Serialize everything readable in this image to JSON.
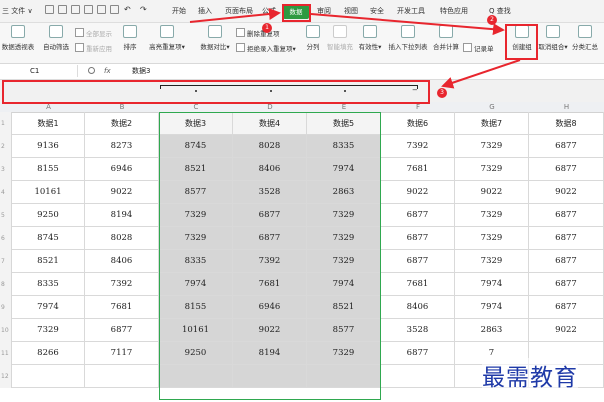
{
  "menu": {
    "file": "三 文件 ∨",
    "tabs": [
      "开始",
      "插入",
      "页面布局",
      "公式",
      "数据",
      "审阅",
      "视图",
      "安全",
      "开发工具",
      "特色应用"
    ],
    "active_tab": "数据",
    "search": "Q 查找"
  },
  "ribbon": {
    "pivot": "数据透视表",
    "auto_filter": "自动筛选",
    "show_all": "全部显示",
    "reapply": "重新应用",
    "sort": "排序",
    "highlight_dup": "高亮重复项",
    "compare": "数据对比",
    "remove_dup": "删除重复项",
    "reject_dup": "拒绝录入重复项",
    "split": "分列",
    "smart_fill": "智能填充",
    "validity": "有效性",
    "dropdown_list": "插入下拉列表",
    "merge_calc": "合并计算",
    "record_form": "记录单",
    "create_group": "创建组",
    "ungroup": "取消组合",
    "subtotal": "分类汇总"
  },
  "formula_bar": {
    "cell_ref": "C1",
    "fx": "fx",
    "content": "数据3"
  },
  "columns": [
    "A",
    "B",
    "C",
    "D",
    "E",
    "F",
    "G",
    "H"
  ],
  "rows": [
    "1",
    "2",
    "3",
    "4",
    "5",
    "6",
    "7",
    "8",
    "9",
    "10",
    "11",
    "12"
  ],
  "table": {
    "headers": [
      "数据1",
      "数据2",
      "数据3",
      "数据4",
      "数据5",
      "数据6",
      "数据7",
      "数据8"
    ],
    "data": [
      [
        "9136",
        "8273",
        "8745",
        "8028",
        "8335",
        "7392",
        "7329",
        "6877"
      ],
      [
        "8155",
        "6946",
        "8521",
        "8406",
        "7974",
        "7681",
        "7329",
        "6877"
      ],
      [
        "10161",
        "9022",
        "8577",
        "3528",
        "2863",
        "9022",
        "9022",
        "9022"
      ],
      [
        "9250",
        "8194",
        "7329",
        "6877",
        "7329",
        "6877",
        "7329",
        "6877"
      ],
      [
        "8745",
        "8028",
        "7329",
        "6877",
        "7329",
        "6877",
        "7329",
        "6877"
      ],
      [
        "8521",
        "8406",
        "8335",
        "7392",
        "7329",
        "6877",
        "7329",
        "6877"
      ],
      [
        "8335",
        "7392",
        "7974",
        "7681",
        "7974",
        "7681",
        "7974",
        "6877"
      ],
      [
        "7974",
        "7681",
        "8155",
        "6946",
        "8521",
        "8406",
        "7974",
        "6877"
      ],
      [
        "7329",
        "6877",
        "10161",
        "9022",
        "8577",
        "3528",
        "2863",
        "9022"
      ],
      [
        "8266",
        "7117",
        "9250",
        "8194",
        "7329",
        "6877",
        "7",
        ""
      ]
    ]
  },
  "annotations": {
    "badge1": "1",
    "badge2": "2",
    "badge3": "3"
  },
  "watermark": "最需教育",
  "colors": {
    "active_tab": "#2e9a41",
    "selection_border": "#2fa84f",
    "annotation": "#e8262e",
    "watermark": "#1f3aa8"
  }
}
